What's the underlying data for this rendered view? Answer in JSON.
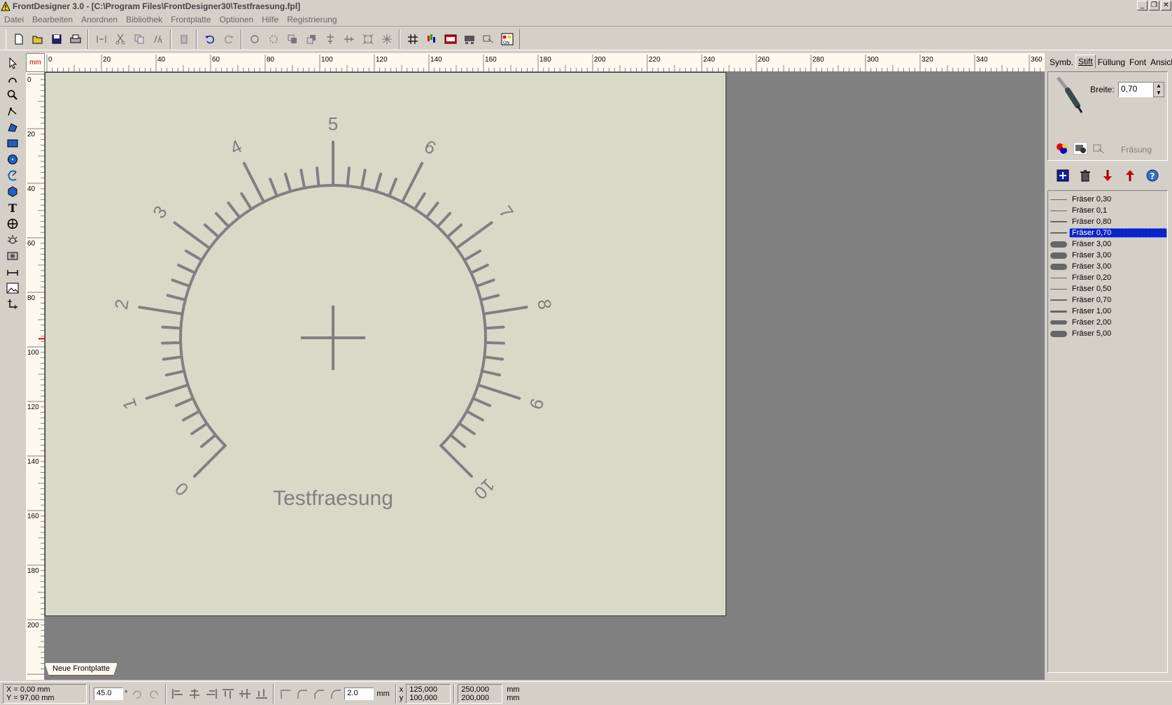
{
  "window": {
    "title": "FrontDesigner 3.0 - [C:\\Program Files\\FrontDesigner30\\Testfraesung.fpl]",
    "buttons": [
      "_",
      "❐",
      "✕"
    ]
  },
  "menu": [
    "Datei",
    "Bearbeiten",
    "Anordnen",
    "Bibliothek",
    "Frontplatte",
    "Optionen",
    "Hilfe",
    "Registrierung"
  ],
  "ruler": {
    "unit": "mm",
    "top_labels": [
      "0",
      "20",
      "40",
      "60",
      "80",
      "100",
      "120",
      "140",
      "160",
      "180",
      "200",
      "220",
      "240",
      "260",
      "280",
      "300",
      "320",
      "340",
      "360"
    ],
    "left_labels": [
      "0",
      "20",
      "40",
      "60",
      "80",
      "100",
      "120",
      "140",
      "160",
      "180",
      "200"
    ]
  },
  "canvas": {
    "dial_labels": [
      "0",
      "1",
      "2",
      "3",
      "4",
      "5",
      "6",
      "7",
      "8",
      "9",
      "10"
    ],
    "engraving_text": "Testfraesung",
    "sheet_tab": "Neue Frontplatte",
    "colors": {
      "panel": "#d9d9c8",
      "stroke": "#808080"
    }
  },
  "right_panel": {
    "tabs": [
      "Symb.",
      "Stift",
      "Füllung",
      "Font",
      "Ansicht"
    ],
    "active_tab": "Stift",
    "breite_label": "Breite:",
    "breite_value": "0,70",
    "mode_label": "Fräsung",
    "pens": [
      {
        "label": "Fräser 0,30",
        "weight": 1
      },
      {
        "label": "Fräser 0,1",
        "weight": 1
      },
      {
        "label": "Fräser 0,80",
        "weight": 2
      },
      {
        "label": "Fräser 0,70",
        "weight": 2,
        "selected": true
      },
      {
        "label": "Fräser 3,00",
        "weight": 9
      },
      {
        "label": "Fräser 3,00",
        "weight": 9
      },
      {
        "label": "Fräser 3,00",
        "weight": 9
      },
      {
        "label": "Fräser 0,20",
        "weight": 1
      },
      {
        "label": "Fräser 0,50",
        "weight": 1
      },
      {
        "label": "Fräser 0,70",
        "weight": 2
      },
      {
        "label": "Fräser 1,00",
        "weight": 3
      },
      {
        "label": "Fräser 2,00",
        "weight": 6
      },
      {
        "label": "Fräser 5,00",
        "weight": 9
      }
    ]
  },
  "status": {
    "cursor_x": "X = 0,00 mm",
    "cursor_y": "Y = 97,00 mm",
    "angle": "45.0",
    "degree": "°",
    "grid_step": "2.0",
    "grid_unit": "mm",
    "pos_x_label": "x",
    "pos_y_label": "y",
    "pos_x": "125,000",
    "pos_y": "100,000",
    "size_w": "250,000",
    "size_h": "200,000",
    "size_unit_1": "mm",
    "size_unit_2": "mm"
  }
}
